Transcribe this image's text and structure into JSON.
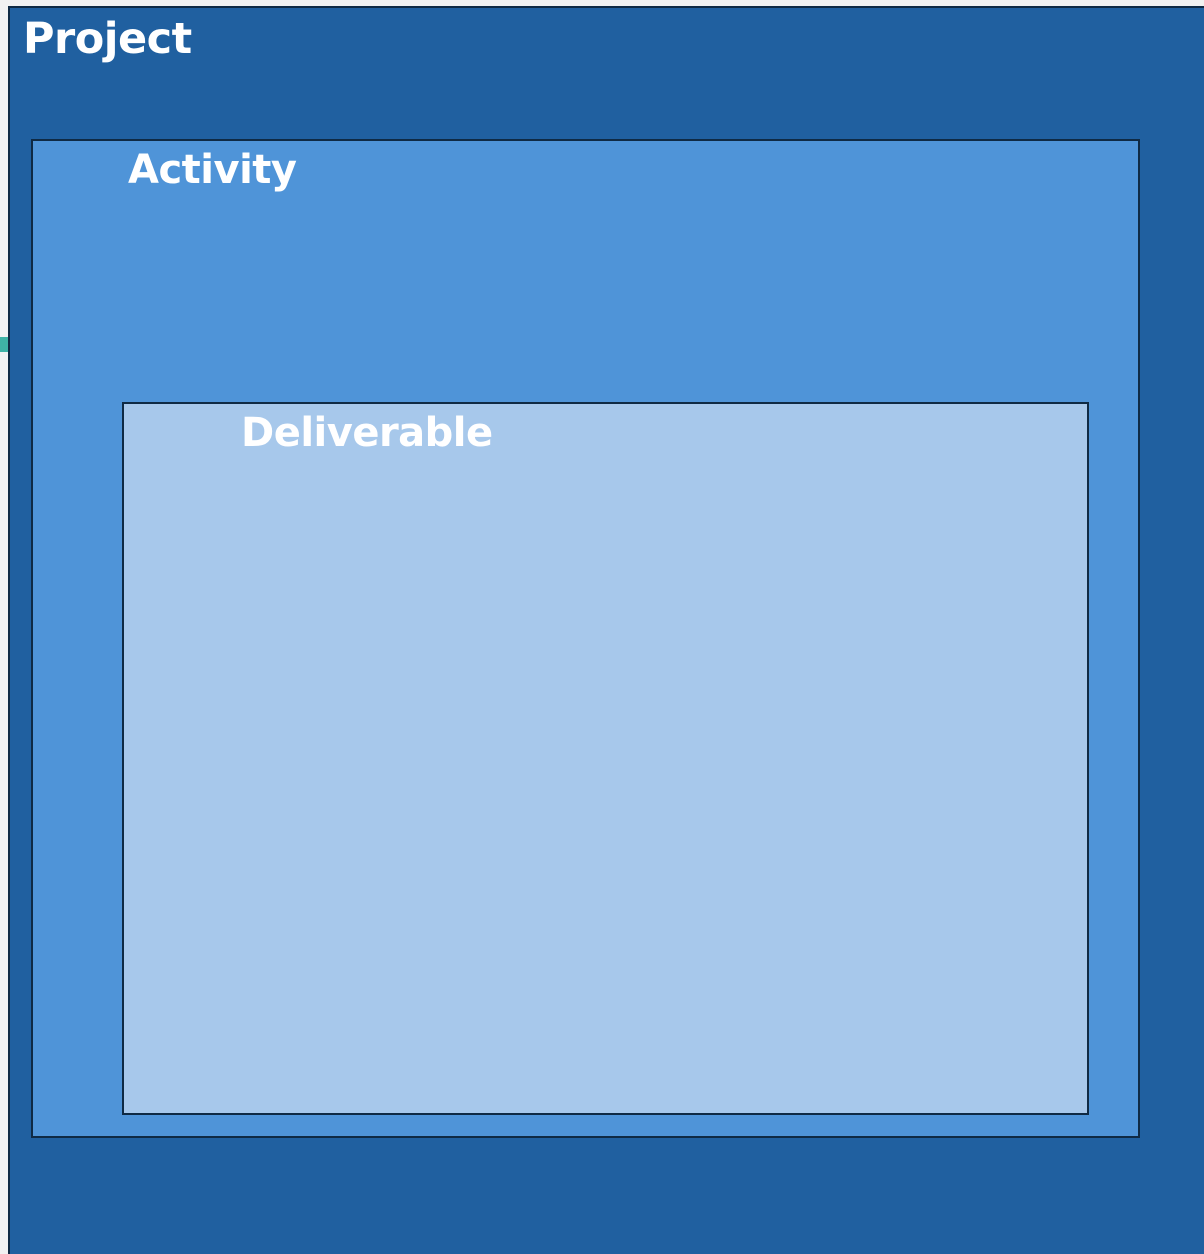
{
  "colors": {
    "project_fill": "#2060a0",
    "activity_fill": "#4f94d8",
    "deliverable_fill": "#a7c8eb",
    "border": "#0f2a44",
    "edge_marker": "#3fb3a6"
  },
  "project": {
    "label": "Project"
  },
  "activity": {
    "label": "Activity"
  },
  "deliverable": {
    "label": "Deliverable"
  }
}
